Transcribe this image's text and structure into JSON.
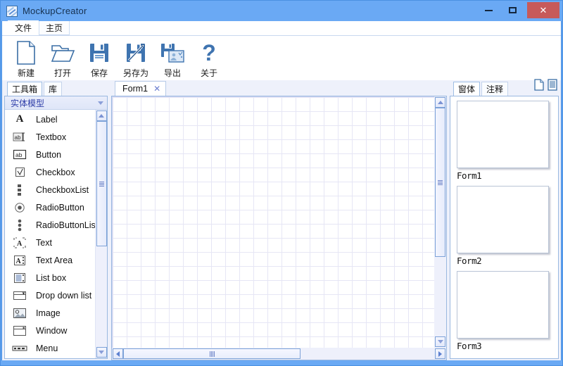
{
  "window": {
    "title": "MockupCreator",
    "icon": "app-window-icon",
    "controls": {
      "minimize": "minimize-icon",
      "maximize": "maximize-icon",
      "close": "✕"
    }
  },
  "ribbon": {
    "tabs": [
      {
        "label": "文件",
        "active": true
      },
      {
        "label": "主页",
        "active": false
      }
    ],
    "buttons": [
      {
        "label": "新建",
        "icon": "new-document-icon"
      },
      {
        "label": "打开",
        "icon": "open-folder-icon"
      },
      {
        "label": "保存",
        "icon": "save-floppy-icon"
      },
      {
        "label": "另存为",
        "icon": "save-as-icon"
      },
      {
        "label": "导出",
        "icon": "export-icon"
      },
      {
        "label": "关于",
        "icon": "question-mark-icon"
      }
    ]
  },
  "toolbox": {
    "tabs": [
      {
        "label": "工具箱",
        "active": true
      },
      {
        "label": "库",
        "active": false
      }
    ],
    "section_title": "实体模型",
    "section_collapse_icon": "chevron-down-icon",
    "items": [
      {
        "label": "Label",
        "icon": "label-a-icon"
      },
      {
        "label": "Textbox",
        "icon": "textbox-icon"
      },
      {
        "label": "Button",
        "icon": "button-icon"
      },
      {
        "label": "Checkbox",
        "icon": "checkbox-icon"
      },
      {
        "label": "CheckboxList",
        "icon": "checkbox-list-icon"
      },
      {
        "label": "RadioButton",
        "icon": "radio-button-icon"
      },
      {
        "label": "RadioButtonList",
        "icon": "radio-button-list-icon"
      },
      {
        "label": "Text",
        "icon": "text-icon"
      },
      {
        "label": "Text Area",
        "icon": "text-area-icon"
      },
      {
        "label": "List box",
        "icon": "list-box-icon"
      },
      {
        "label": "Drop down list",
        "icon": "drop-down-list-icon"
      },
      {
        "label": "Image",
        "icon": "image-icon"
      },
      {
        "label": "Window",
        "icon": "window-icon"
      },
      {
        "label": "Menu",
        "icon": "menu-icon"
      }
    ],
    "scroll_up_icon": "scroll-up-arrow",
    "scroll_down_icon": "scroll-down-arrow"
  },
  "editor": {
    "tabs": [
      {
        "label": "Form1",
        "close": "✕",
        "active": true
      }
    ],
    "canvas": {
      "grid": true,
      "grid_size_px": 20,
      "grid_color": "#e6e6f5"
    },
    "scroll_up_icon": "scroll-up-arrow",
    "scroll_down_icon": "scroll-down-arrow",
    "scroll_left_icon": "scroll-left-arrow",
    "scroll_right_icon": "scroll-right-arrow"
  },
  "forms_panel": {
    "tabs": [
      {
        "label": "窗体",
        "active": true
      },
      {
        "label": "注释",
        "active": false
      }
    ],
    "icons": [
      {
        "name": "new-form-icon"
      },
      {
        "name": "form-list-icon"
      }
    ],
    "forms": [
      {
        "name": "Form1"
      },
      {
        "name": "Form2"
      },
      {
        "name": "Form3"
      }
    ]
  },
  "colors": {
    "title_bar": "#6aa9f4",
    "close_button": "#c75a5a",
    "accent": "#3a6ea5",
    "panel_bg": "#eef1fb",
    "section_title": "#2e3ea8"
  }
}
